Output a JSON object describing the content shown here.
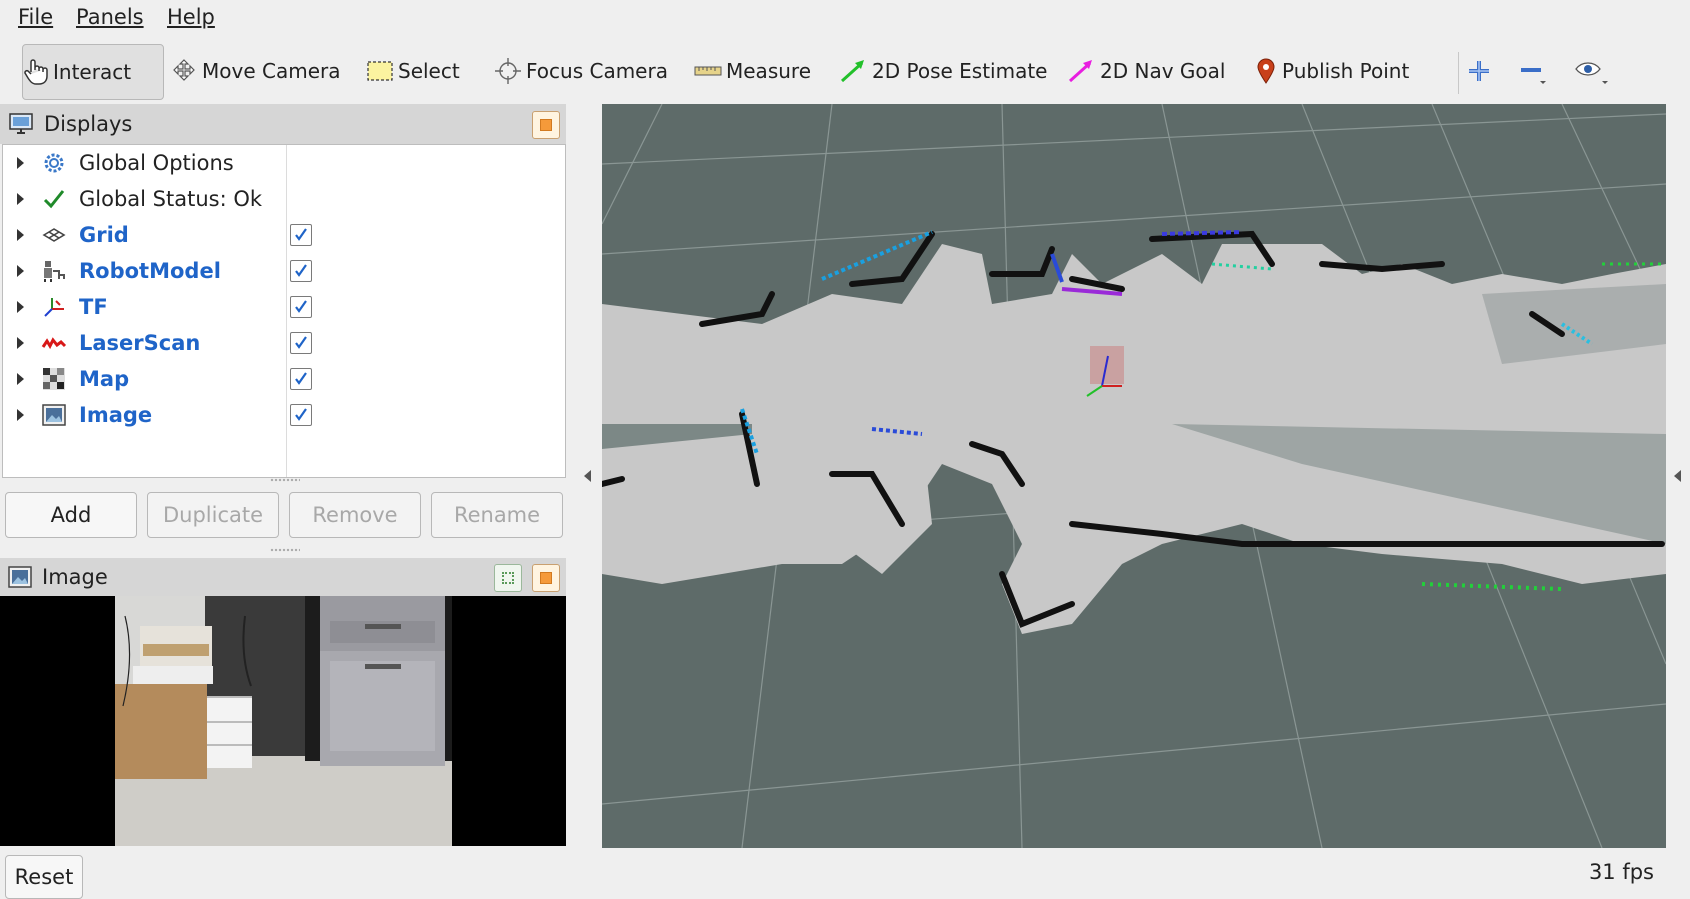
{
  "menu": {
    "file": "File",
    "panels": "Panels",
    "help": "Help"
  },
  "toolbar": {
    "interact": "Interact",
    "move_camera": "Move Camera",
    "select": "Select",
    "focus_camera": "Focus Camera",
    "measure": "Measure",
    "pose_estimate": "2D Pose Estimate",
    "nav_goal": "2D Nav Goal",
    "publish_point": "Publish Point"
  },
  "displays_panel": {
    "title": "Displays",
    "items": [
      {
        "label": "Global Options",
        "icon": "gear-icon",
        "checked": null
      },
      {
        "label": "Global Status: Ok",
        "icon": "checkmark-icon",
        "checked": null
      },
      {
        "label": "Grid",
        "icon": "grid-icon",
        "checked": true
      },
      {
        "label": "RobotModel",
        "icon": "robot-icon",
        "checked": true
      },
      {
        "label": "TF",
        "icon": "axes-icon",
        "checked": true
      },
      {
        "label": "LaserScan",
        "icon": "laser-icon",
        "checked": true
      },
      {
        "label": "Map",
        "icon": "map-icon",
        "checked": true
      },
      {
        "label": "Image",
        "icon": "image-icon",
        "checked": true
      }
    ],
    "buttons": {
      "add": "Add",
      "duplicate": "Duplicate",
      "remove": "Remove",
      "rename": "Rename"
    }
  },
  "image_panel": {
    "title": "Image"
  },
  "status": {
    "reset": "Reset",
    "fps": "31 fps"
  },
  "colors": {
    "viewport_bg": "#5e6b69",
    "map_free": "#c8c8c8",
    "link_blue": "#1f64c8"
  }
}
